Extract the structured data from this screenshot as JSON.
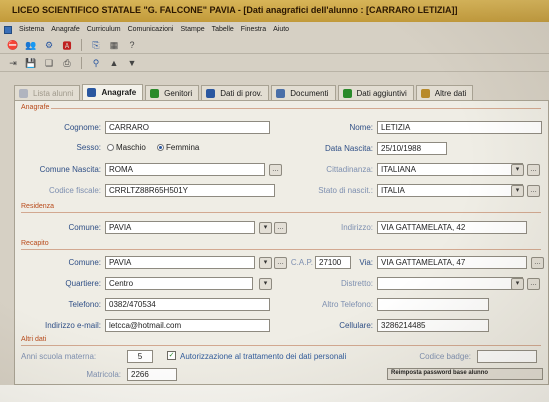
{
  "window": {
    "title": "LICEO SCIENTIFICO STATALE \"G. FALCONE\" PAVIA - [Dati anagrafici dell'alunno : [CARRARO LETIZIA]]"
  },
  "menu": [
    "Sistema",
    "Anagrafe",
    "Curriculum",
    "Comunicazioni",
    "Stampe",
    "Tabelle",
    "Finestra",
    "Aiuto"
  ],
  "tabs": [
    {
      "label": "Lista alunni",
      "active": false,
      "dim": true,
      "color": "#9aa0b0"
    },
    {
      "label": "Anagrafe",
      "active": true,
      "dim": false,
      "color": "#2a57a0"
    },
    {
      "label": "Genitori",
      "active": false,
      "dim": false,
      "color": "#2a8a2a"
    },
    {
      "label": "Dati di prov.",
      "active": false,
      "dim": false,
      "color": "#2a57a0"
    },
    {
      "label": "Documenti",
      "active": false,
      "dim": false,
      "color": "#4a6fa8"
    },
    {
      "label": "Dati aggiuntivi",
      "active": false,
      "dim": false,
      "color": "#2a8a2a"
    },
    {
      "label": "Altre dati",
      "active": false,
      "dim": false,
      "color": "#b88a2a"
    }
  ],
  "sections": {
    "anagrafe": "Anagrafe",
    "residenza": "Residenza",
    "recapito": "Recapito",
    "altri": "Altri dati"
  },
  "anagrafe": {
    "cognome_label": "Cognome:",
    "cognome": "CARRARO",
    "nome_label": "Nome:",
    "nome": "LETIZIA",
    "sesso_label": "Sesso:",
    "sesso_m": "Maschio",
    "sesso_f": "Femmina",
    "data_nascita_label": "Data Nascita:",
    "data_nascita": "25/10/1988",
    "comune_nascita_label": "Comune Nascita:",
    "comune_nascita": "ROMA",
    "cittadinanza_label": "Cittadinanza:",
    "cittadinanza": "ITALIANA",
    "codice_fiscale_label": "Codice fiscale:",
    "codice_fiscale": "CRRLTZ88R65H501Y",
    "stato_label": "Stato di nascit.:",
    "stato": "ITALIA"
  },
  "residenza": {
    "comune_label": "Comune:",
    "comune": "PAVIA",
    "indirizzo_label": "Indirizzo:",
    "indirizzo": "VIA GATTAMELATA, 42"
  },
  "recapito": {
    "comune_label": "Comune:",
    "comune": "PAVIA",
    "cap_label": "C.A.P.",
    "cap": "27100",
    "via_label": "Via:",
    "via": "VIA GATTAMELATA, 47",
    "quartiere_label": "Quartiere:",
    "quartiere": "Centro",
    "distretto_label": "Distretto:",
    "distretto": "",
    "telefono_label": "Telefono:",
    "telefono": "0382/470534",
    "altro_tel_label": "Altro Telefono:",
    "altro_tel": "",
    "email_label": "Indirizzo e-mail:",
    "email": "letcca@hotmail.com",
    "cellulare_label": "Cellulare:",
    "cellulare": "3286214485"
  },
  "altri": {
    "anni_label": "Anni scuola materna:",
    "anni": "5",
    "autorizzazione_label": "Autorizzazione al trattamento dei dati personali",
    "codice_badge_label": "Codice badge:",
    "codice_badge": "",
    "matricola_label": "Matricola:",
    "matricola": "2266",
    "reset_password": "Reimposta password base alunno"
  }
}
